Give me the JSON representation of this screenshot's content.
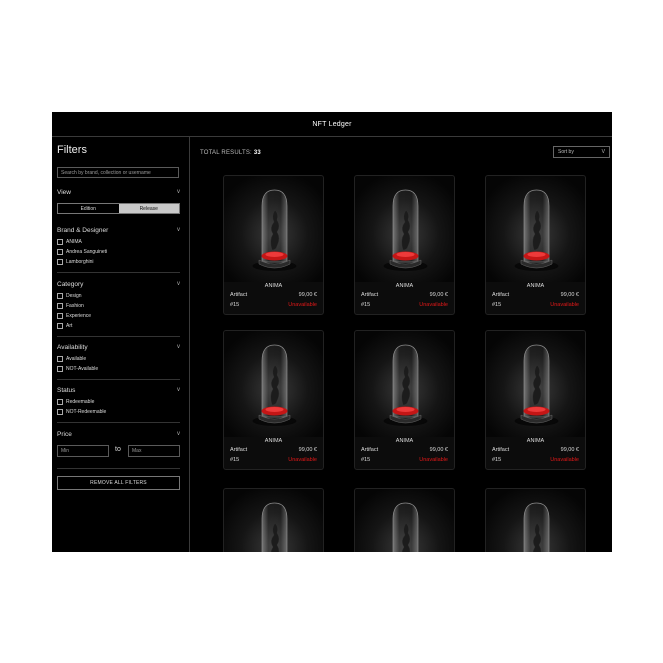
{
  "window": {
    "title": "NFT Ledger"
  },
  "sidebar": {
    "title": "Filters",
    "search_placeholder": "Search by brand, collection or username",
    "view": {
      "label": "View",
      "options": [
        "Edition",
        "Release"
      ],
      "selected": "Release"
    },
    "brand": {
      "label": "Brand & Designer",
      "items": [
        "ANIMA",
        "Andrea Sanguineti",
        "Lamborghini"
      ]
    },
    "category": {
      "label": "Category",
      "items": [
        "Design",
        "Fashion",
        "Experience",
        "Art"
      ]
    },
    "availability": {
      "label": "Availability",
      "items": [
        "Available",
        "NOT-Available"
      ]
    },
    "status": {
      "label": "Status",
      "items": [
        "Redeemable",
        "NOT-Redeemable"
      ]
    },
    "price": {
      "label": "Price",
      "min_placeholder": "Min",
      "max_placeholder": "Max",
      "to_label": "to"
    },
    "remove_all_label": "REMOVE ALL FILTERS"
  },
  "main": {
    "total_label": "TOTAL RESULTS:",
    "total_count": "33",
    "sort_label": "Sort by",
    "sort_chevron": "V",
    "cards": [
      {
        "name": "ANIMA",
        "type": "Artifact",
        "price": "99,00 €",
        "edition": "#15",
        "status": "Unavailable"
      },
      {
        "name": "ANIMA",
        "type": "Artifact",
        "price": "99,00 €",
        "edition": "#15",
        "status": "Unavailable"
      },
      {
        "name": "ANIMA",
        "type": "Artifact",
        "price": "99,00 €",
        "edition": "#15",
        "status": "Unavailable"
      },
      {
        "name": "ANIMA",
        "type": "Artifact",
        "price": "99,00 €",
        "edition": "#15",
        "status": "Unavailable"
      },
      {
        "name": "ANIMA",
        "type": "Artifact",
        "price": "99,00 €",
        "edition": "#15",
        "status": "Unavailable"
      },
      {
        "name": "ANIMA",
        "type": "Artifact",
        "price": "99,00 €",
        "edition": "#15",
        "status": "Unavailable"
      },
      {
        "name": "",
        "type": "",
        "price": "",
        "edition": "",
        "status": ""
      },
      {
        "name": "",
        "type": "",
        "price": "",
        "edition": "",
        "status": ""
      },
      {
        "name": "",
        "type": "",
        "price": "",
        "edition": "",
        "status": ""
      }
    ]
  },
  "colors": {
    "background": "#000000",
    "accent_red": "#e01818",
    "unavailable": "#e01818"
  },
  "icons": {
    "section_toggle": "chevron-down-icon"
  }
}
